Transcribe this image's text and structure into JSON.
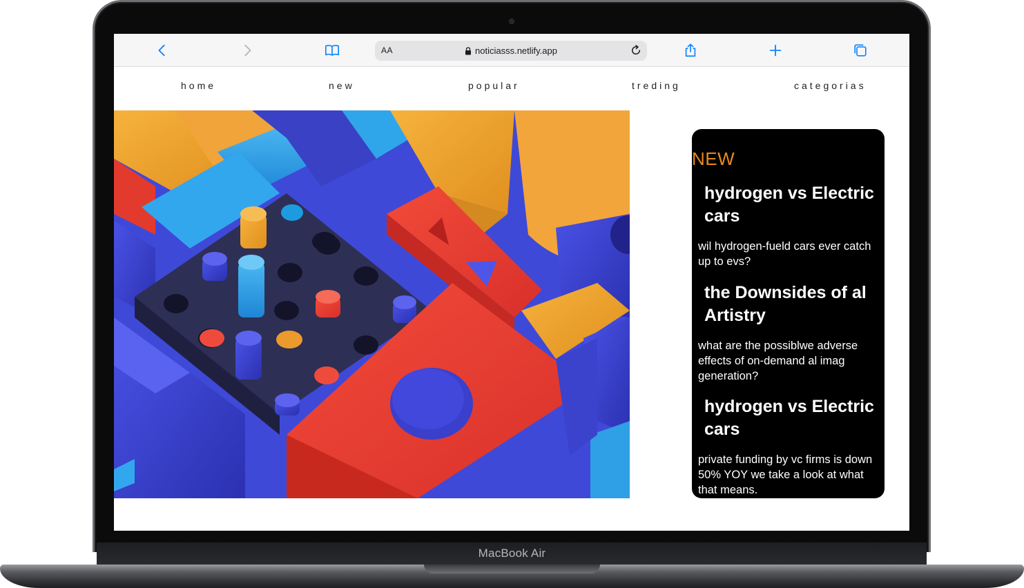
{
  "device": {
    "brand_label": "MacBook Air"
  },
  "browser": {
    "text_size_label": "AA",
    "url": "noticiasss.netlify.app",
    "icons": {
      "back": "chevron-left-icon",
      "forward": "chevron-right-icon",
      "bookmarks": "book-icon",
      "lock": "lock-icon",
      "reload": "reload-icon",
      "share": "share-icon",
      "new_tab": "plus-icon",
      "tabs": "tabs-icon"
    },
    "accent_color": "#0a84ff"
  },
  "site": {
    "nav": [
      {
        "label": "home"
      },
      {
        "label": "new"
      },
      {
        "label": "popular"
      },
      {
        "label": "treding"
      },
      {
        "label": "categorias"
      }
    ],
    "news": {
      "badge": "NEW",
      "badge_color": "#e8891e",
      "stories": [
        {
          "title": "hydrogen vs Electric cars",
          "description": "wil hydrogen-fueld cars ever catch up to evs?"
        },
        {
          "title": "the Downsides of al Artistry",
          "description": "what are the possiblwe adverse effects of on-demand al imag generation?"
        },
        {
          "title": "hydrogen vs Electric cars",
          "description": "private funding by vc firms is down 50% YOY we take a look at what that means."
        }
      ]
    }
  }
}
